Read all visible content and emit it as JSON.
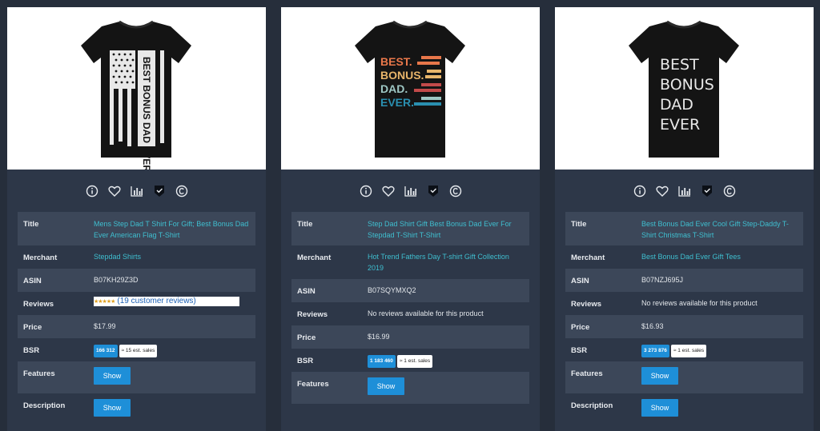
{
  "labels": {
    "title": "Title",
    "merchant": "Merchant",
    "asin": "ASIN",
    "reviews": "Reviews",
    "price": "Price",
    "bsr": "BSR",
    "features": "Features",
    "description": "Description",
    "show": "Show"
  },
  "icons": [
    "info-icon",
    "heart-icon",
    "chart-icon",
    "badge-icon",
    "copyright-icon"
  ],
  "colors": {
    "background": "#262e3b",
    "card": "#2d3748",
    "row_alt": "#3c4759",
    "link": "#3fbfd0",
    "button": "#1e8fd8"
  },
  "products": [
    {
      "image_text": "BEST BONUS DAD EVER",
      "title": "Mens Step Dad T Shirt For Gift; Best Bonus Dad Ever American Flag T-Shirt",
      "merchant": "Stepdad Shirts",
      "asin": "B07KH29Z3D",
      "reviews": "(19 customer reviews)",
      "reviews_stars": "★★★★★",
      "price": "$17.99",
      "bsr_rank": "166 312",
      "bsr_sales": "≈ 15 est. sales"
    },
    {
      "image_text": [
        "BEST.",
        "BONUS.",
        "DAD.",
        "EVER."
      ],
      "title": "Step Dad Shirt Gift Best Bonus Dad Ever For Stepdad T-Shirt T-Shirt",
      "merchant": "Hot Trend Fathers Day T-shirt Gift Collection 2019",
      "asin": "B07SQYMXQ2",
      "reviews": "No reviews available for this product",
      "price": "$16.99",
      "bsr_rank": "1 183 460",
      "bsr_sales": "≈ 1 est. sales"
    },
    {
      "image_text": [
        "BEST",
        "BONUS",
        "DAD",
        "EVER"
      ],
      "title": "Best Bonus Dad Ever Cool Gift Step-Daddy T-Shirt Christmas T-Shirt",
      "merchant": "Best Bonus Dad Ever Gift Tees",
      "asin": "B07NZJ695J",
      "reviews": "No reviews available for this product",
      "price": "$16.93",
      "bsr_rank": "3 273 876",
      "bsr_sales": "≈ 1 est. sales"
    }
  ]
}
